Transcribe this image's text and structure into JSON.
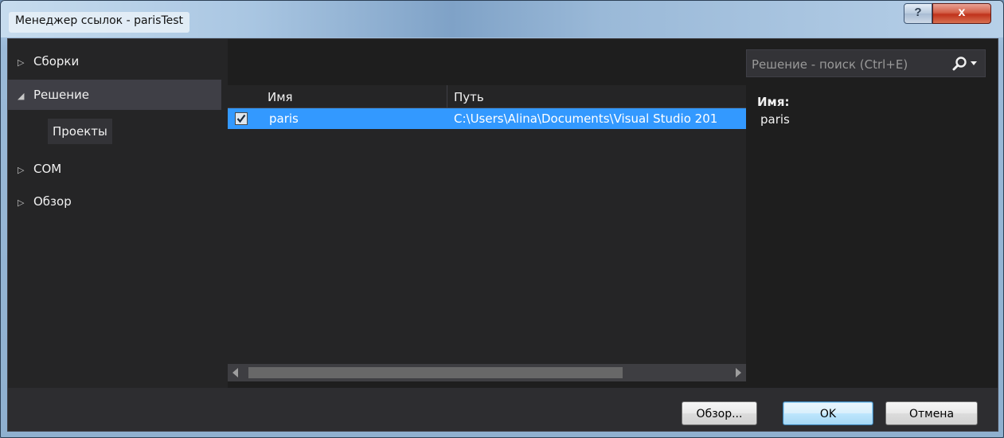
{
  "window": {
    "title": "Менеджер ссылок - parisTest",
    "help_label": "?",
    "close_label": "x"
  },
  "nav": {
    "items": [
      {
        "label": "Сборки",
        "expanded": false
      },
      {
        "label": "Решение",
        "expanded": true
      },
      {
        "label": "COM",
        "expanded": false
      },
      {
        "label": "Обзор",
        "expanded": false
      }
    ],
    "subitems": [
      {
        "label": "Проекты"
      }
    ]
  },
  "search": {
    "placeholder": "Решение - поиск (Ctrl+E)"
  },
  "grid": {
    "columns": [
      "Имя",
      "Путь"
    ],
    "rows": [
      {
        "checked": true,
        "name": "paris",
        "path": "C:\\Users\\Alina\\Documents\\Visual Studio 201"
      }
    ]
  },
  "details": {
    "name_label": "Имя:",
    "name_value": "paris"
  },
  "buttons": {
    "browse": "Обзор...",
    "ok": "OK",
    "cancel": "Отмена"
  },
  "colors": {
    "selection": "#3399ff",
    "background": "#252526",
    "panel": "#1e1e1e",
    "footer": "#2d2d30"
  }
}
